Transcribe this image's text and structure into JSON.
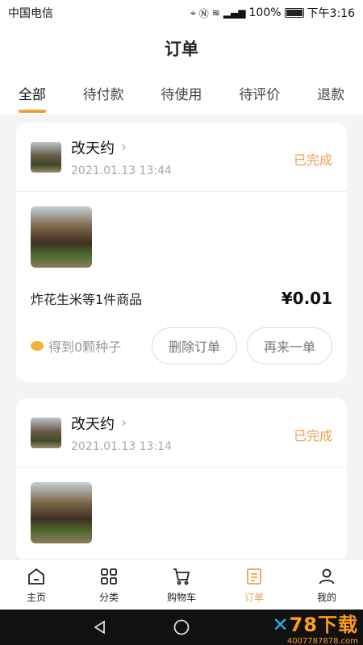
{
  "status_bar": {
    "carrier": "中国电信",
    "battery": "100%",
    "time": "下午3:16"
  },
  "header": {
    "title": "订单"
  },
  "tabs": [
    {
      "label": "全部",
      "active": true
    },
    {
      "label": "待付款",
      "active": false
    },
    {
      "label": "待使用",
      "active": false
    },
    {
      "label": "待评价",
      "active": false
    },
    {
      "label": "退款",
      "active": false
    }
  ],
  "orders": [
    {
      "shop_name": "改天约",
      "time": "2021.01.13 13:44",
      "status": "已完成",
      "product_name": "炸花生米等1件商品",
      "price": "¥0.01",
      "seed_text": "得到0颗种子",
      "delete_label": "删除订单",
      "reorder_label": "再来一单"
    },
    {
      "shop_name": "改天约",
      "time": "2021.01.13 13:14",
      "status": "已完成"
    }
  ],
  "bottom_nav": [
    {
      "label": "主页",
      "icon": "home-icon"
    },
    {
      "label": "分类",
      "icon": "grid-icon"
    },
    {
      "label": "购物车",
      "icon": "cart-icon"
    },
    {
      "label": "订单",
      "icon": "order-icon",
      "active": true
    },
    {
      "label": "我的",
      "icon": "user-icon"
    }
  ],
  "watermark": {
    "main": "78下载",
    "sub": "4007787878.com"
  },
  "colors": {
    "accent": "#e8a450",
    "tab_indicator": "#f0a03a"
  }
}
